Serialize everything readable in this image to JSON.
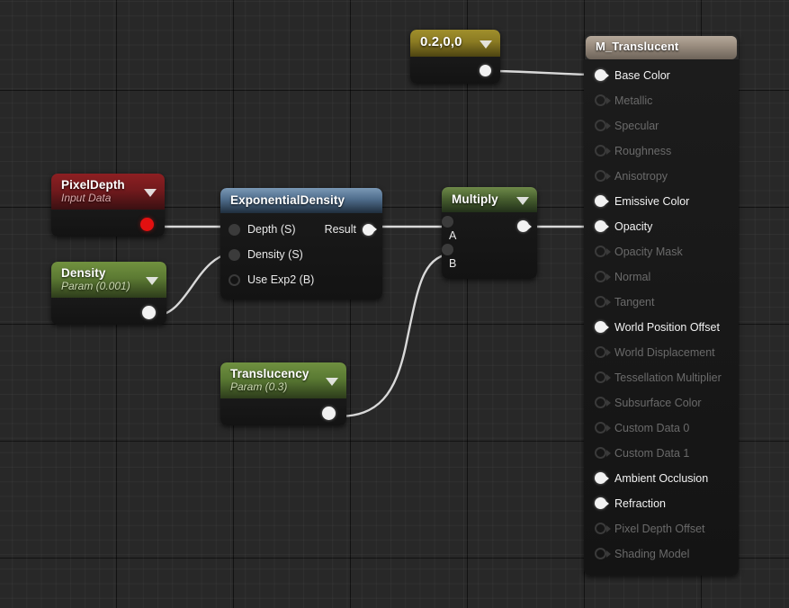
{
  "editor": {
    "name": "material-graph-editor"
  },
  "colors": {
    "canvas_bg": "#282828",
    "wire": "#d9d9d9",
    "pin_connected": "#f2f2f2",
    "pin_unconnected": "#3a3a3a",
    "pixeldepth_header": "#8d1f22",
    "param_header": "#5c7a33",
    "constant_header": "#8a7a22",
    "expression_header": "#4f6d8c",
    "multiply_header": "#48602f",
    "material_header": "#9b8e80",
    "pixeldepth_out_pin": "#e31010"
  },
  "nodes": {
    "constant": {
      "title": "0.2,0,0",
      "caret": "chevron-down-icon",
      "output_pin": "out"
    },
    "pixeldepth": {
      "title": "PixelDepth",
      "subtitle": "Input Data",
      "caret": "chevron-down-icon"
    },
    "density": {
      "title": "Density",
      "subtitle": "Param (0.001)",
      "caret": "chevron-down-icon"
    },
    "translucency": {
      "title": "Translucency",
      "subtitle": "Param (0.3)",
      "caret": "chevron-down-icon"
    },
    "exponential_density": {
      "title": "ExponentialDensity",
      "inputs": [
        {
          "label": "Depth (S)",
          "connected": true
        },
        {
          "label": "Density (S)",
          "connected": true
        },
        {
          "label": "Use Exp2 (B)",
          "connected": false
        }
      ],
      "outputs": [
        {
          "label": "Result",
          "connected": true
        }
      ]
    },
    "multiply": {
      "title": "Multiply",
      "caret": "chevron-down-icon",
      "inputs": [
        {
          "label": "A",
          "connected": true
        },
        {
          "label": "B",
          "connected": true
        }
      ],
      "outputs": [
        {
          "label": "",
          "connected": true
        }
      ]
    },
    "material": {
      "title": "M_Translucent",
      "pins": [
        {
          "label": "Base Color",
          "connected": true
        },
        {
          "label": "Metallic",
          "connected": false
        },
        {
          "label": "Specular",
          "connected": false
        },
        {
          "label": "Roughness",
          "connected": false
        },
        {
          "label": "Anisotropy",
          "connected": false
        },
        {
          "label": "Emissive Color",
          "connected": true
        },
        {
          "label": "Opacity",
          "connected": true
        },
        {
          "label": "Opacity Mask",
          "connected": false
        },
        {
          "label": "Normal",
          "connected": false
        },
        {
          "label": "Tangent",
          "connected": false
        },
        {
          "label": "World Position Offset",
          "connected": true
        },
        {
          "label": "World Displacement",
          "connected": false
        },
        {
          "label": "Tessellation Multiplier",
          "connected": false
        },
        {
          "label": "Subsurface Color",
          "connected": false
        },
        {
          "label": "Custom Data 0",
          "connected": false
        },
        {
          "label": "Custom Data 1",
          "connected": false
        },
        {
          "label": "Ambient Occlusion",
          "connected": true
        },
        {
          "label": "Refraction",
          "connected": true
        },
        {
          "label": "Pixel Depth Offset",
          "connected": false
        },
        {
          "label": "Shading Model",
          "connected": false
        }
      ]
    }
  },
  "connections": [
    {
      "from": "constant.out",
      "to": "material.base_color"
    },
    {
      "from": "pixeldepth.out",
      "to": "exponential_density.depth"
    },
    {
      "from": "density.out",
      "to": "exponential_density.density"
    },
    {
      "from": "exponential_density.result",
      "to": "multiply.a"
    },
    {
      "from": "translucency.out",
      "to": "multiply.b"
    },
    {
      "from": "multiply.out",
      "to": "material.opacity"
    }
  ]
}
